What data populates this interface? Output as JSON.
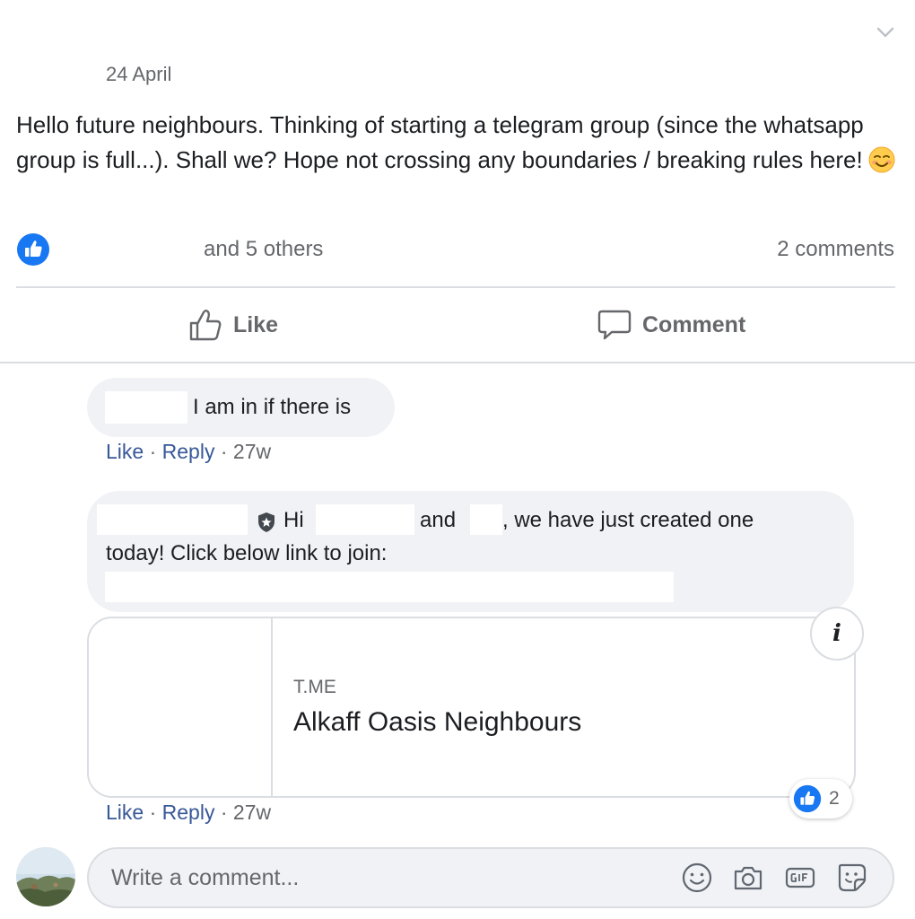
{
  "post": {
    "date": "24 April",
    "text": "Hello future neighbours. Thinking of starting a telegram group (since the whatsapp group is full...). Shall we? Hope not crossing any boundaries / breaking rules here!",
    "emoji_icon": "smiling-face-emoji",
    "reactions_summary": "and 5 others",
    "comments_count": "2 comments",
    "collapse_icon": "chevron-down-icon"
  },
  "actions": {
    "like_label": "Like",
    "comment_label": "Comment"
  },
  "comments": [
    {
      "text": "I am in if there is",
      "like": "Like",
      "separator": "·",
      "reply": "Reply",
      "ago": "27w"
    },
    {
      "greeting": "Hi",
      "and_word": "and",
      "text_tail": ", we have just created one",
      "line2": "today! Click below link to join:",
      "link_preview": {
        "domain": "T.ME",
        "title": "Alkaff Oasis Neighbours",
        "info_icon": "i"
      },
      "reaction_count": "2",
      "like": "Like",
      "separator": "·",
      "reply": "Reply",
      "ago": "27w"
    }
  ],
  "composer": {
    "placeholder": "Write a comment...",
    "icons": [
      "emoji-icon",
      "camera-icon",
      "gif-icon",
      "sticker-icon"
    ]
  },
  "colors": {
    "facebook_blue": "#1877f2",
    "link_blue": "#385898",
    "muted_text": "#65676b",
    "bubble_bg": "#f0f2f5"
  }
}
